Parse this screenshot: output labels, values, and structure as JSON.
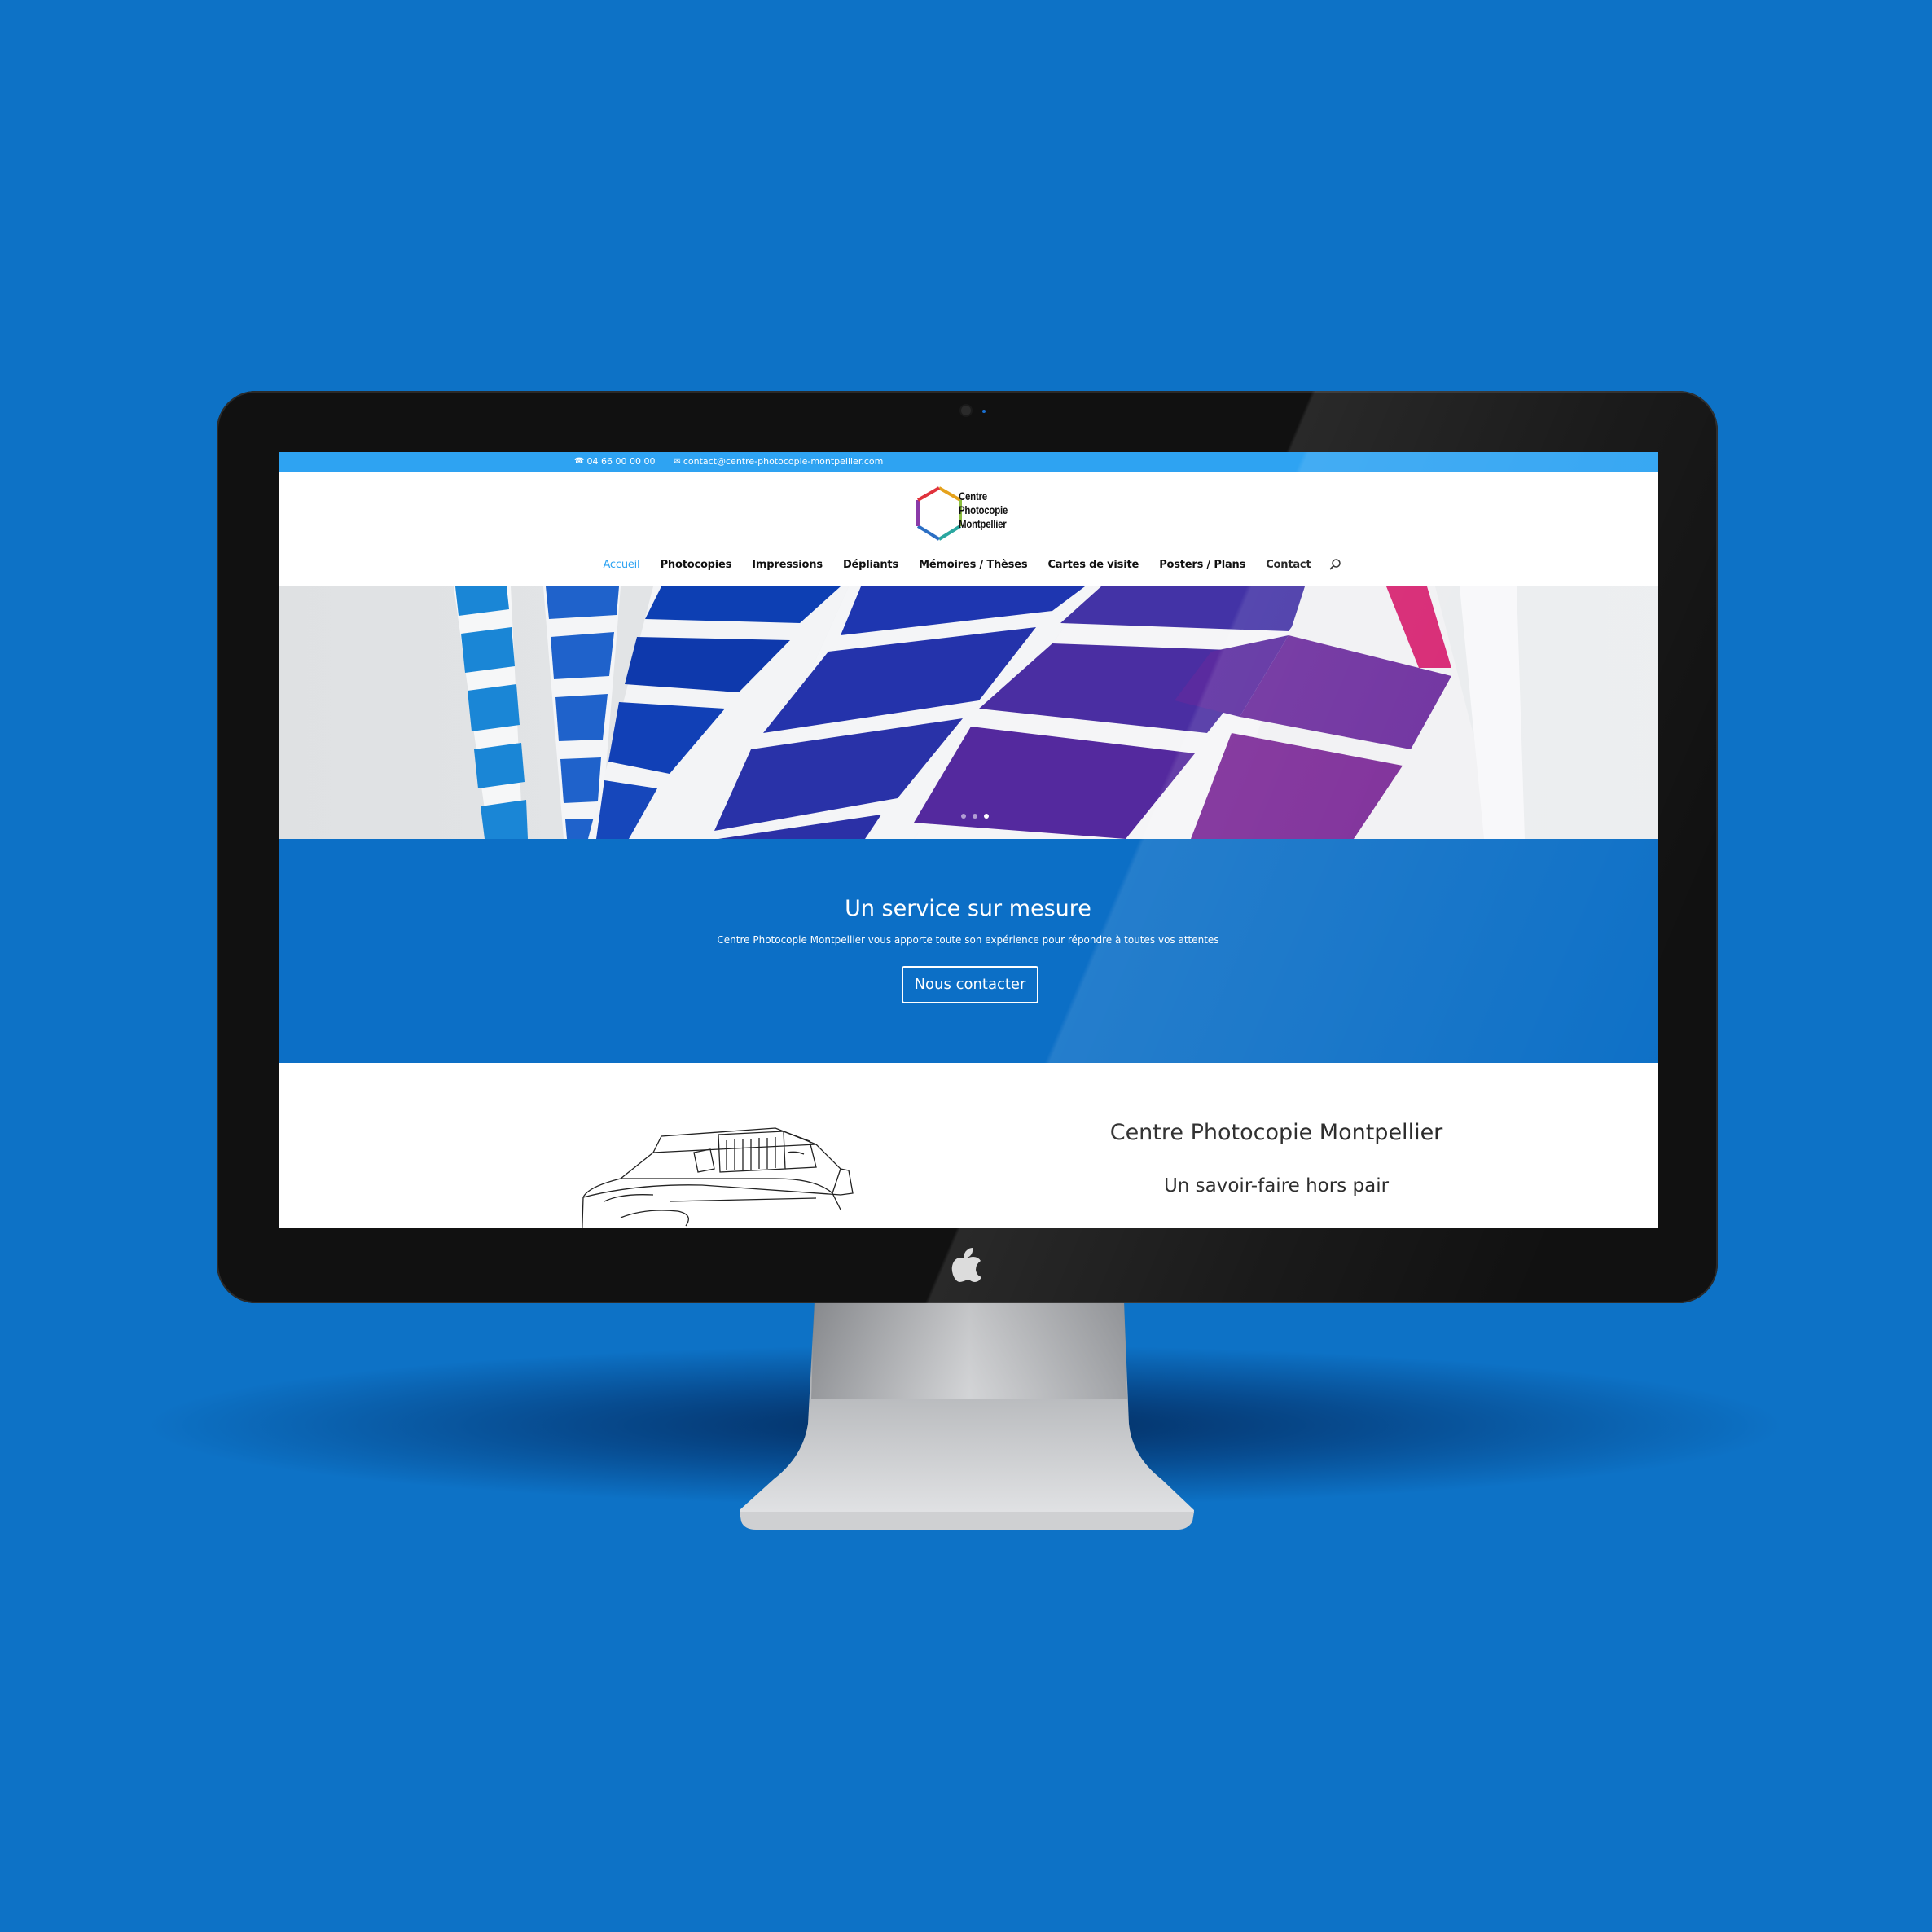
{
  "colors": {
    "background": "#0d72c6",
    "topbar": "#2ea3f2",
    "accent": "#2ea3f2",
    "cta_band": "#0c6fc6"
  },
  "topbar": {
    "phone_icon": "phone-icon",
    "phone": "04 66 00 00 00",
    "email_icon": "mail-icon",
    "email": "contact@centre-photocopie-montpellier.com"
  },
  "logo": {
    "line1": "Centre",
    "line2": "Photocopie",
    "line3": "Montpellier"
  },
  "nav": {
    "items": [
      {
        "label": "Accueil",
        "active": true
      },
      {
        "label": "Photocopies"
      },
      {
        "label": "Impressions"
      },
      {
        "label": "Dépliants"
      },
      {
        "label": "Mémoires / Thèses"
      },
      {
        "label": "Cartes de visite"
      },
      {
        "label": "Posters / Plans"
      },
      {
        "label": "Contact"
      }
    ],
    "search_icon": "search-icon"
  },
  "slider": {
    "slide_count": 3,
    "active_slide": 3
  },
  "cta": {
    "title": "Un service sur mesure",
    "subtitle": "Centre Photocopie Montpellier vous apporte toute son expérience pour répondre à toutes vos attentes",
    "button": "Nous contacter"
  },
  "section2": {
    "title": "Centre Photocopie Montpellier",
    "subtitle": "Un savoir-faire hors pair"
  }
}
